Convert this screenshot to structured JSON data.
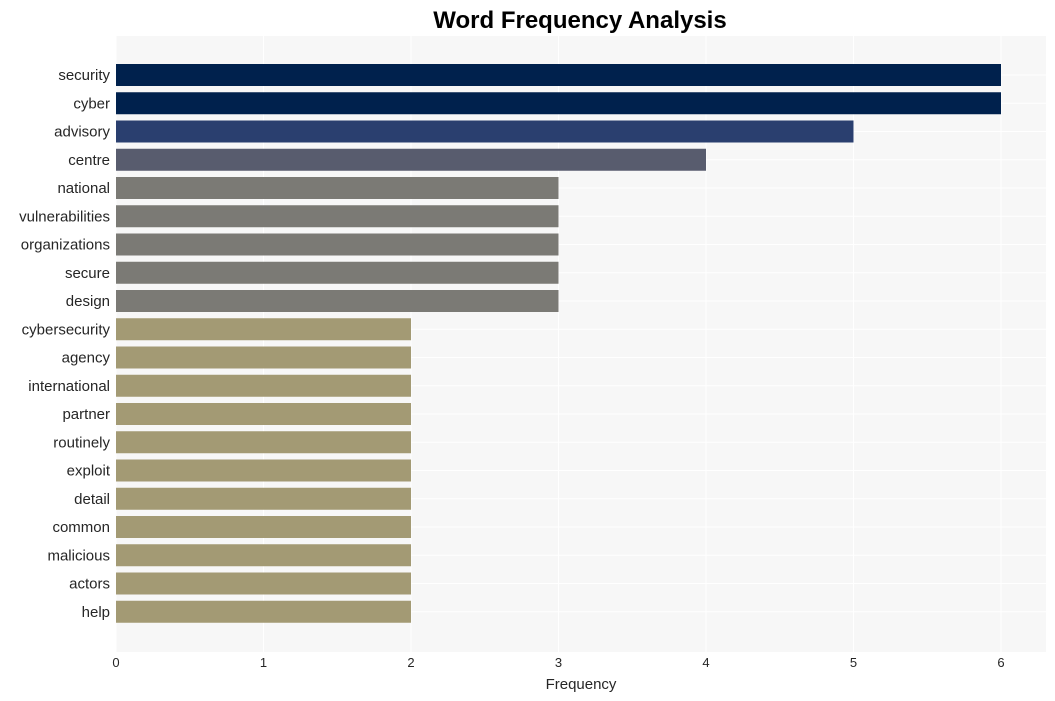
{
  "chart_data": {
    "type": "bar",
    "orientation": "horizontal",
    "title": "Word Frequency Analysis",
    "xlabel": "Frequency",
    "ylabel": "",
    "xlim": [
      0,
      6.3
    ],
    "xticks": [
      0,
      1,
      2,
      3,
      4,
      5,
      6
    ],
    "grid": true,
    "categories": [
      "security",
      "cyber",
      "advisory",
      "centre",
      "national",
      "vulnerabilities",
      "organizations",
      "secure",
      "design",
      "cybersecurity",
      "agency",
      "international",
      "partner",
      "routinely",
      "exploit",
      "detail",
      "common",
      "malicious",
      "actors",
      "help"
    ],
    "values": [
      6,
      6,
      5,
      4,
      3,
      3,
      3,
      3,
      3,
      2,
      2,
      2,
      2,
      2,
      2,
      2,
      2,
      2,
      2,
      2
    ],
    "colors": {
      "6": "#00214d",
      "5": "#2a3f6f",
      "4": "#585c6e",
      "3": "#7b7a75",
      "2": "#a39a74"
    },
    "background": "#f7f7f7"
  }
}
